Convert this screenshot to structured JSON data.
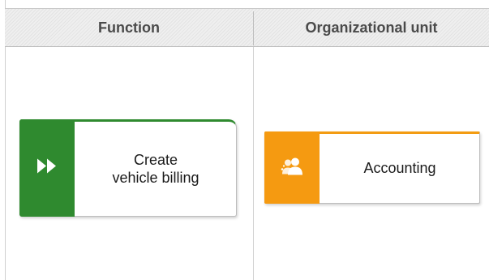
{
  "lanes": {
    "function_header": "Function",
    "org_header": "Organizational unit"
  },
  "function_box": {
    "label": "Create\nvehicle billing",
    "icon": "fast-forward-icon",
    "color": "#2f8a2f"
  },
  "org_box": {
    "label": "Accounting",
    "icon": "group-icon",
    "color": "#f59a11"
  }
}
